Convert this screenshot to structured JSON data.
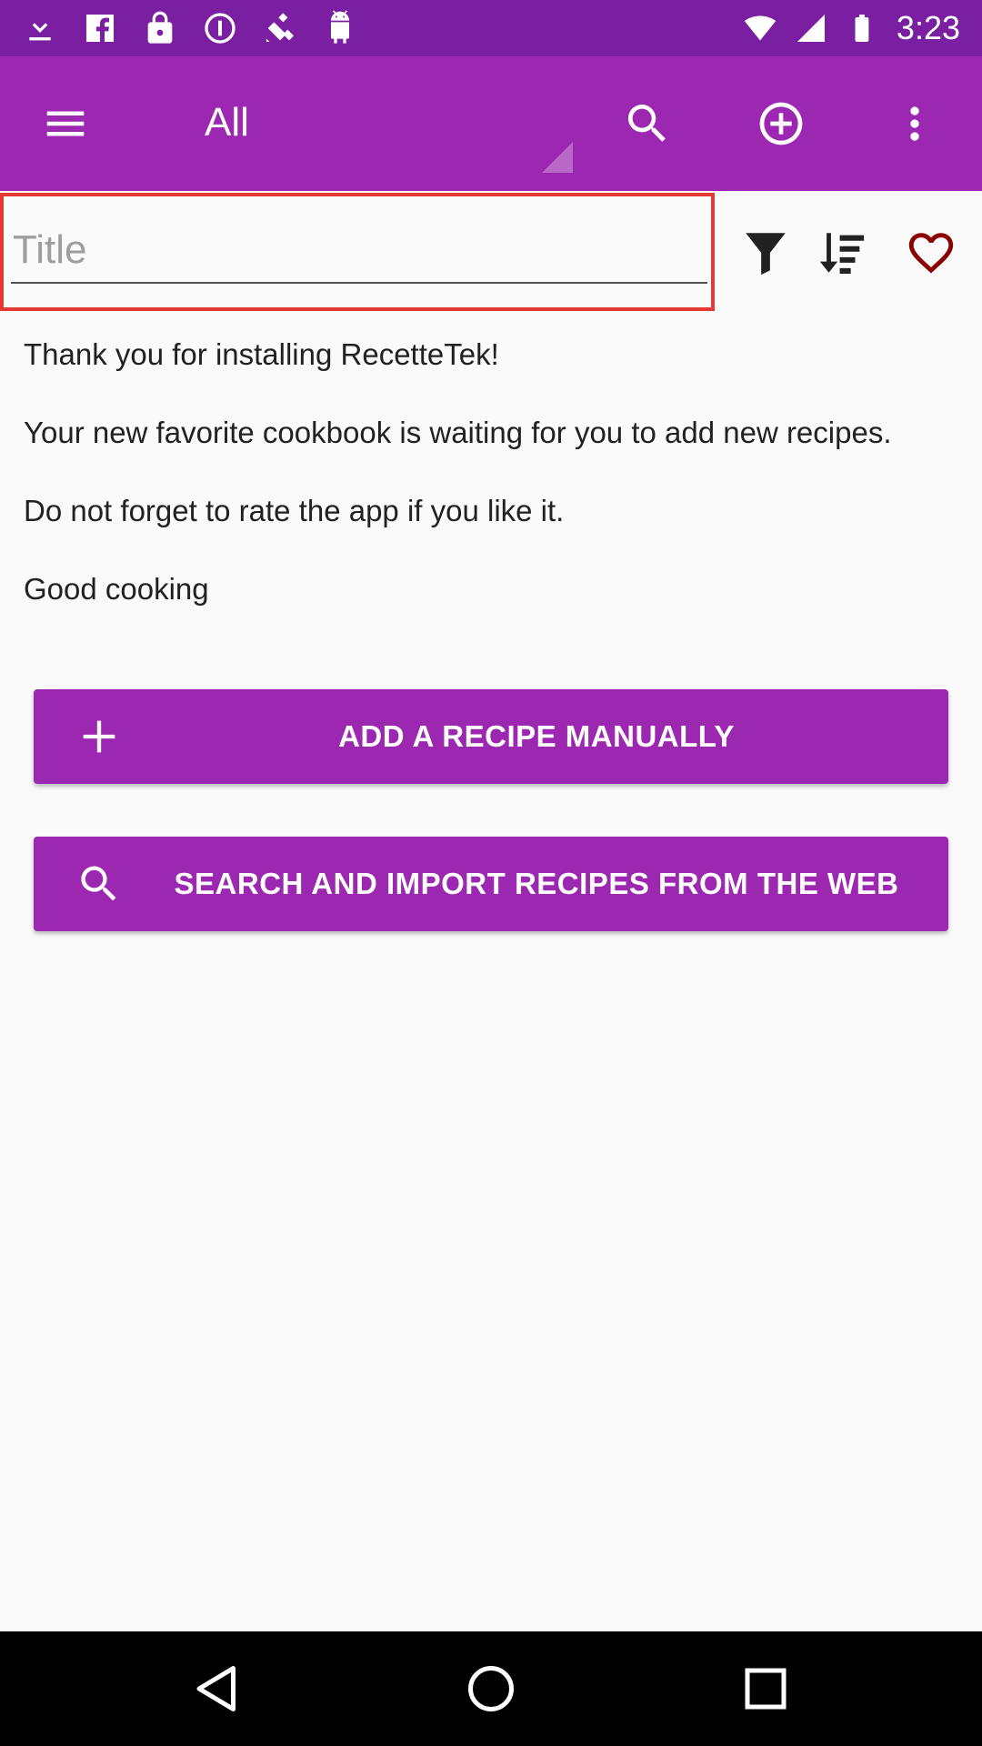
{
  "status_bar": {
    "time": "3:23",
    "icons": [
      "download-icon",
      "facebook-icon",
      "lock-icon",
      "info-icon",
      "fake-gps-icon",
      "android-icon",
      "wifi-icon",
      "signal-icon",
      "battery-icon"
    ]
  },
  "app_bar": {
    "menu_icon": "hamburger-menu-icon",
    "spinner_label": "All",
    "actions": [
      "search-icon",
      "add-circle-icon",
      "more-vert-icon"
    ]
  },
  "filter_row": {
    "title_placeholder": "Title",
    "title_value": "",
    "icons": [
      "filter-icon",
      "sort-icon",
      "heart-icon"
    ],
    "heart_color": "#8b0000"
  },
  "welcome": {
    "line1": "Thank you for installing RecetteTek!",
    "line2": "Your new favorite cookbook is waiting for you to add new recipes.",
    "line3": "Do not forget to rate the app if you like it.",
    "line4": "Good cooking"
  },
  "buttons": {
    "add_manually": "ADD A RECIPE MANUALLY",
    "search_web": "SEARCH AND IMPORT RECIPES FROM THE WEB"
  },
  "colors": {
    "primary": "#9c27b0",
    "primary_dark": "#7b1fa2",
    "highlight_border": "#e53935"
  },
  "nav_bar": {
    "icons": [
      "back-icon",
      "home-icon",
      "recents-icon"
    ]
  }
}
